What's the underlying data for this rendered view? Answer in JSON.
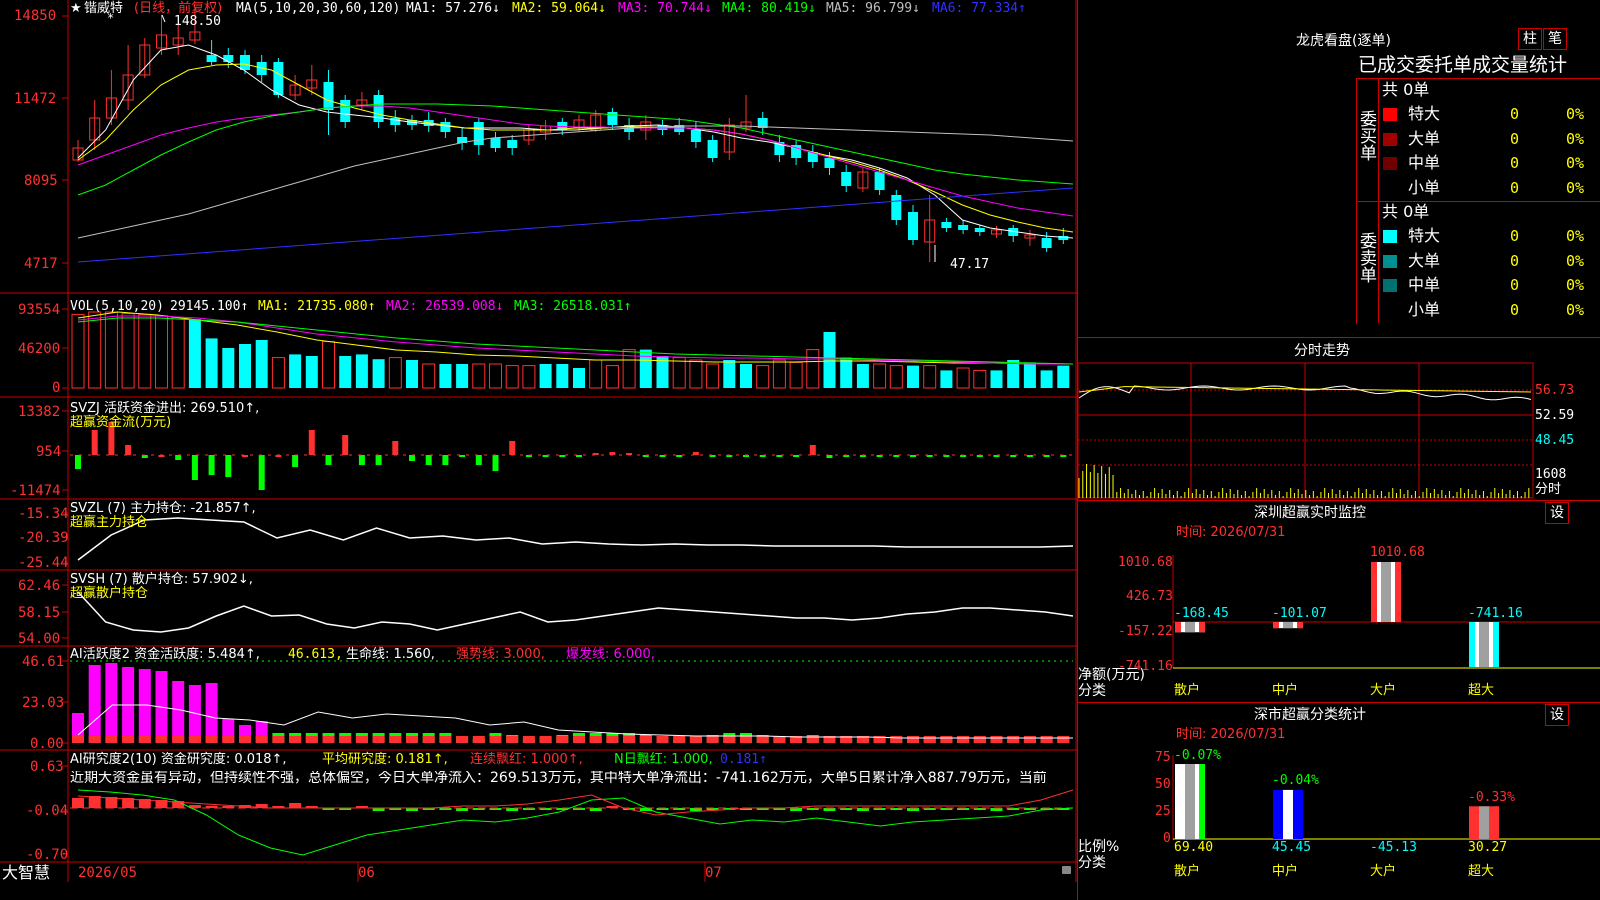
{
  "app": {
    "brand": "大智慧"
  },
  "main": {
    "stock_name": "锴威特",
    "period_tag": "(日线，前复权)",
    "ma_title": "MA(5,10,20,30,60,120)",
    "ma_items": [
      {
        "label": "MA1: 57.276↓",
        "color": "#ffffff"
      },
      {
        "label": "MA2: 59.064↓",
        "color": "#ffff00"
      },
      {
        "label": "MA3: 70.744↓",
        "color": "#ff00ff"
      },
      {
        "label": "MA4: 80.419↓",
        "color": "#00ff00"
      },
      {
        "label": "MA5: 96.799↓",
        "color": "#c0c0c0"
      },
      {
        "label": "MA6: 77.334↑",
        "color": "#3030ff"
      }
    ],
    "y_ticks": [
      "14850",
      "11472",
      "8095",
      "4717"
    ],
    "high_label": "148.50",
    "low_label": "47.17"
  },
  "vol": {
    "title": "VOL(5,10,20)",
    "value": "29145.100↑",
    "ma1": "MA1: 21735.080↑",
    "ma2": "MA2: 26539.008↓",
    "ma3": "MA3: 26518.031↑",
    "y_ticks": [
      "93554",
      "46200",
      "0"
    ]
  },
  "svzj": {
    "line1": "SVZJ  活跃资金进出: 269.510↑,",
    "line2": "超赢资金流(万元)",
    "y_ticks": [
      "13382",
      "954",
      "-11474"
    ]
  },
  "svzl": {
    "line1": "SVZL (7) 主力持仓: -21.857↑,",
    "line2": "超赢主力持仓",
    "y_ticks": [
      "-15.34",
      "-20.39",
      "-25.44"
    ]
  },
  "svsh": {
    "line1": "SVSH (7) 散户持仓: 57.902↓,",
    "line2": "超赢散户持仓",
    "y_ticks": [
      "62.46",
      "58.15",
      "54.00"
    ]
  },
  "ai1": {
    "t1": "AI活跃度2 资金活跃度: 5.484↑,",
    "t2": "46.613,",
    "t3": "生命线: 1.560,",
    "t4": "强势线: 3.000,",
    "t5": "爆发线: 6.000,",
    "y_ticks": [
      "46.61",
      "23.03",
      "0.00"
    ]
  },
  "ai2": {
    "t1": "AI研究度2(10) 资金研究度: 0.018↑,",
    "t2": "平均研究度: 0.181↑,",
    "t3": "连续飘红: 1.000↑,",
    "t4": "N日飘红: 1.000,",
    "t5": "0.181↑",
    "comment": "近期大资金虽有异动，但持续性不强，总体偏空，今日大单净流入：269.513万元，其中特大单净流出：-741.162万元，大单5日累计净入887.79万元，当前",
    "y_ticks": [
      "0.63",
      "-0.04",
      "-0.70"
    ]
  },
  "xaxis": {
    "labels": [
      "2026/05",
      "06",
      "07"
    ]
  },
  "longhu": {
    "title": "龙虎看盘(逐单)",
    "btn_bar": "柱",
    "btn_pen": "笔",
    "subtitle": "已成交委托单成交量统计",
    "buy_label": "委买单",
    "sell_label": "委卖单",
    "buy_total": "共 0单",
    "sell_total": "共 0单",
    "buy_rows": [
      {
        "name": "特大",
        "val": "0",
        "pct": "0%",
        "color": "#ff0000"
      },
      {
        "name": "大单",
        "val": "0",
        "pct": "0%",
        "color": "#a00000"
      },
      {
        "name": "中单",
        "val": "0",
        "pct": "0%",
        "color": "#700000"
      },
      {
        "name": "小单",
        "val": "0",
        "pct": "0%",
        "color": "#000000"
      }
    ],
    "sell_rows": [
      {
        "name": "特大",
        "val": "0",
        "pct": "0%",
        "color": "#00ffff"
      },
      {
        "name": "大单",
        "val": "0",
        "pct": "0%",
        "color": "#009090"
      },
      {
        "name": "中单",
        "val": "0",
        "pct": "0%",
        "color": "#007070"
      },
      {
        "name": "小单",
        "val": "0",
        "pct": "0%",
        "color": "#000000"
      }
    ]
  },
  "fenshi": {
    "title": "分时走势",
    "ticks": [
      "56.73",
      "52.59",
      "48.45"
    ],
    "vol_tick": "1608",
    "vol_unit": "分时"
  },
  "sz_monitor": {
    "title": "深圳超赢实时监控",
    "btn": "设",
    "time": "时间: 2026/07/31",
    "ylabel1": "净额(万元)",
    "ylabel2": "分类",
    "y_ticks": [
      "1010.68",
      "426.73",
      "-157.22",
      "-741.16"
    ],
    "categories": [
      "散户",
      "中户",
      "大户",
      "超大"
    ],
    "values": [
      -168.45,
      -101.07,
      1010.68,
      -741.16
    ],
    "value_labels": [
      "-168.45",
      "-101.07",
      "1010.68",
      "-741.16"
    ]
  },
  "sz_class": {
    "title": "深市超赢分类统计",
    "btn": "设",
    "time": "时间: 2026/07/31",
    "ylabel1": "比例%",
    "ylabel2": "分类",
    "y_ticks": [
      "75",
      "50",
      "25",
      "0"
    ],
    "categories": [
      "散户",
      "中户",
      "大户",
      "超大"
    ],
    "values": [
      69.4,
      45.45,
      -45.13,
      30.27
    ],
    "value_labels": [
      "69.40",
      "45.45",
      "-45.13",
      "30.27"
    ],
    "change_labels": [
      "-0.07%",
      "-0.04%",
      "",
      "-0.33%"
    ]
  }
}
